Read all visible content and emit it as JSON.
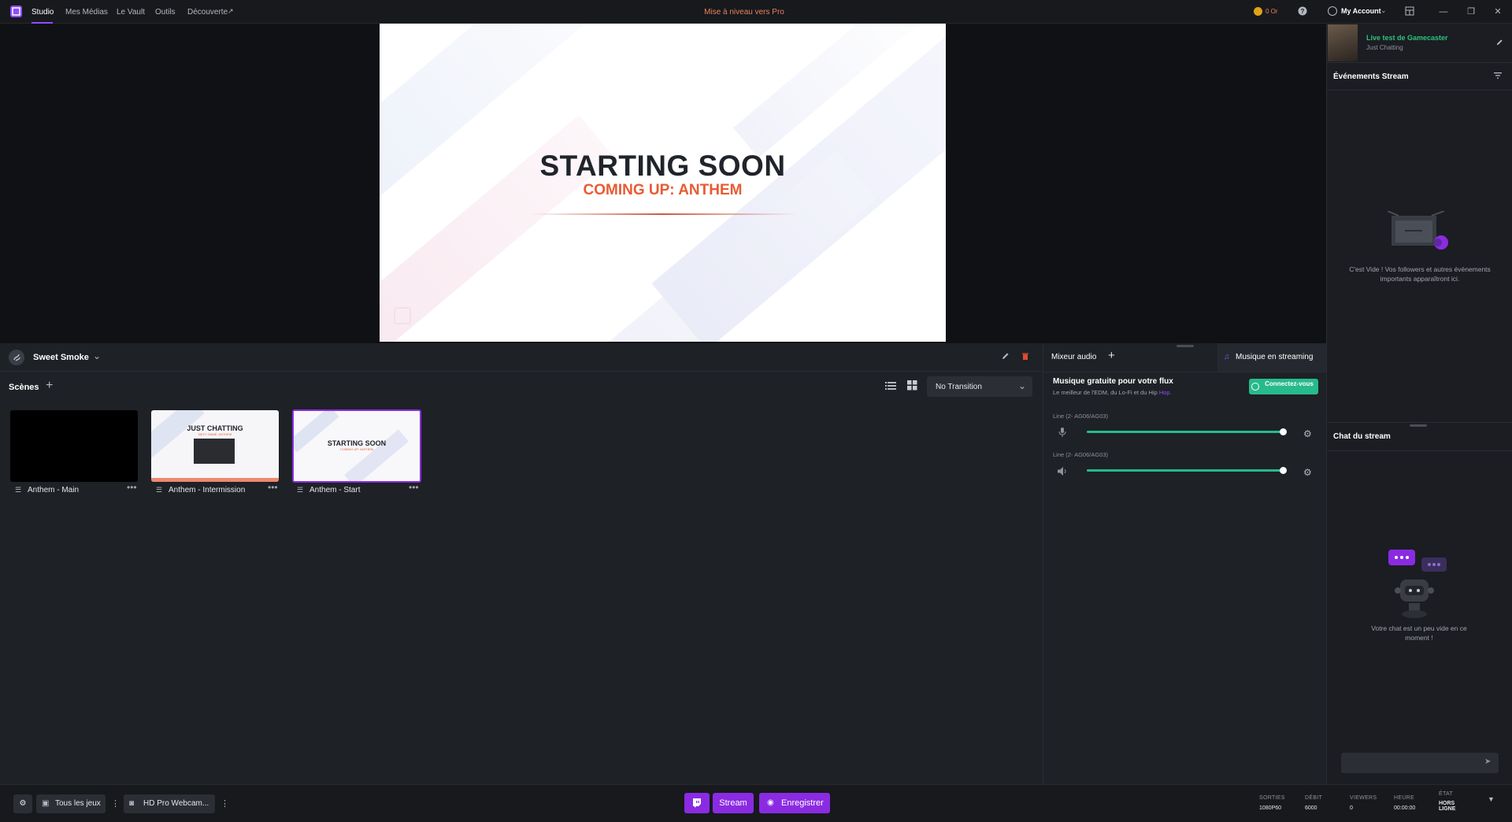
{
  "topbar": {
    "nav": [
      "Studio",
      "Mes Médias",
      "Le Vault",
      "Outils",
      "Découverte"
    ],
    "upgrade": "Mise à niveau vers Pro",
    "coins": "0 Or",
    "account": "My Account"
  },
  "preview": {
    "title": "STARTING SOON",
    "subtitle": "COMING UP: ANTHEM"
  },
  "collection": {
    "name": "Sweet Smoke"
  },
  "scenes": {
    "header": "Scènes",
    "transition": "No Transition",
    "items": [
      {
        "label": "Anthem - Main",
        "thumb_title": "",
        "thumb_sub": ""
      },
      {
        "label": "Anthem - Intermission",
        "thumb_title": "JUST CHATTING",
        "thumb_sub": "NEXT GAME: ANTHEM"
      },
      {
        "label": "Anthem - Start",
        "thumb_title": "STARTING SOON",
        "thumb_sub": "COMING UP: ANTHEM"
      }
    ]
  },
  "audio": {
    "title": "Mixeur audio",
    "music_tab": "Musique en streaming",
    "promo_title": "Musique gratuite pour votre flux",
    "promo_desc_prefix": "Le meilleur de l'EDM, du Lo-Fi et du Hip ",
    "promo_desc_link": "Hop.",
    "connect_label": "Connectez-vous",
    "channels": [
      {
        "name": "Line (2- AG06/AG03)",
        "icon": "microphone-icon",
        "level": 0.95
      },
      {
        "name": "Line (2- AG06/AG03)",
        "icon": "speaker-icon",
        "level": 0.95
      }
    ]
  },
  "sidebar": {
    "stream_title": "Live test de Gamecaster",
    "category": "Just Chatting",
    "events_title": "Événements Stream",
    "events_empty": "C'est Vide ! Vos followers et autres événements importants apparaîtront ici.",
    "chat_title": "Chat du stream",
    "chat_empty": "Votre chat est un peu vide en ce moment !"
  },
  "bottombar": {
    "games": "Tous les jeux",
    "webcam": "HD Pro Webcam...",
    "stream": "Stream",
    "record": "Enregistrer",
    "stats": [
      {
        "label": "SORTIES",
        "value": "1080P60"
      },
      {
        "label": "DÉBIT",
        "value": "6000"
      },
      {
        "label": "VIEWERS",
        "value": "0"
      },
      {
        "label": "HEURE",
        "value": "00:00:00"
      },
      {
        "label": "ÉTAT",
        "value": "HORS LIGNE"
      }
    ]
  },
  "colors": {
    "accent": "#8a2be2",
    "accent_light": "#8a4fff",
    "slider": "#27ba8a",
    "upgrade": "#e8825c",
    "stream_title": "#2ec27e",
    "subtitle_orange": "#e85b33"
  }
}
